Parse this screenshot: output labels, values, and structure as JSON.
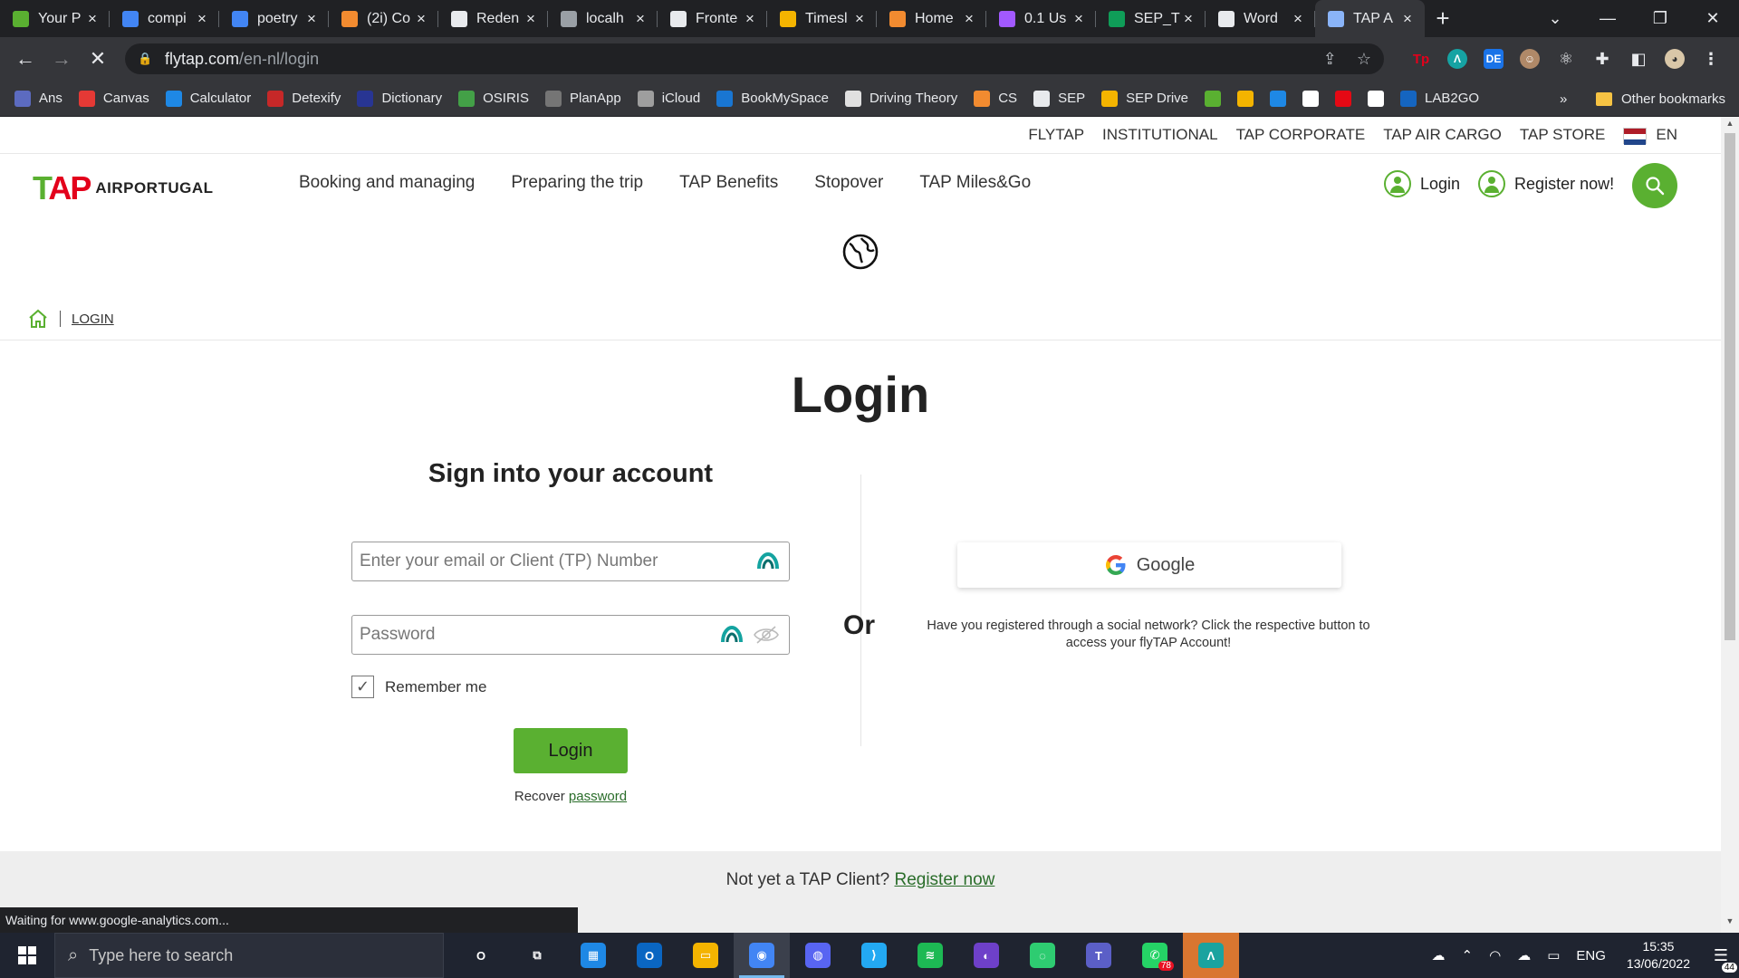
{
  "browser": {
    "tabs": [
      {
        "title": "Your P",
        "favicon": "six-icon",
        "color": "#5ab031"
      },
      {
        "title": "compi",
        "favicon": "google-icon",
        "color": "#4285f4"
      },
      {
        "title": "poetry",
        "favicon": "google-icon",
        "color": "#4285f4"
      },
      {
        "title": "(2i) Co",
        "favicon": "dots-icon",
        "color": "#f28b30"
      },
      {
        "title": "Reden",
        "favicon": "doc-icon",
        "color": "#e8eaed"
      },
      {
        "title": "localh",
        "favicon": "globe-icon",
        "color": "#9aa0a6"
      },
      {
        "title": "Fronte",
        "favicon": "github-icon",
        "color": "#e8eaed"
      },
      {
        "title": "Timesl",
        "favicon": "drive-icon",
        "color": "#f4b400"
      },
      {
        "title": "Home",
        "favicon": "ring-icon",
        "color": "#f28b30"
      },
      {
        "title": "0.1 Us",
        "favicon": "figma-icon",
        "color": "#a259ff"
      },
      {
        "title": "SEP_T",
        "favicon": "sheets-plus-icon",
        "color": "#0f9d58"
      },
      {
        "title": "Word",
        "favicon": "grid-icon",
        "color": "#e8eaed"
      },
      {
        "title": "TAP A",
        "favicon": "loading-icon",
        "color": "#8ab4f8",
        "active": true
      }
    ],
    "new_tab": "+",
    "url_host": "flytap.com",
    "url_path": "/en-nl/login",
    "bookmarks": [
      {
        "label": "Ans",
        "icon": "ans-icon",
        "color": "#5c6bc0"
      },
      {
        "label": "Canvas",
        "icon": "tu-delft-icon",
        "color": "#e53935"
      },
      {
        "label": "Calculator",
        "icon": "calculator-icon",
        "color": "#1e88e5"
      },
      {
        "label": "Detexify",
        "icon": "detexify-icon",
        "color": "#c62828"
      },
      {
        "label": "Dictionary",
        "icon": "dictionary-icon",
        "color": "#283593"
      },
      {
        "label": "OSIRIS",
        "icon": "osiris-icon",
        "color": "#43a047"
      },
      {
        "label": "PlanApp",
        "icon": "globe-icon",
        "color": "#757575"
      },
      {
        "label": "iCloud",
        "icon": "apple-icon",
        "color": "#9e9e9e"
      },
      {
        "label": "BookMySpace",
        "icon": "bookmyspace-icon",
        "color": "#1976d2"
      },
      {
        "label": "Driving Theory",
        "icon": "page-icon",
        "color": "#e0e0e0"
      },
      {
        "label": "CS",
        "icon": "dots-icon",
        "color": "#f28b30"
      },
      {
        "label": "SEP",
        "icon": "doc-icon",
        "color": "#e8eaed"
      },
      {
        "label": "SEP Drive",
        "icon": "drive-icon",
        "color": "#f4b400"
      },
      {
        "label": "",
        "icon": "six-icon",
        "color": "#5ab031"
      },
      {
        "label": "",
        "icon": "drive-icon",
        "color": "#f4b400"
      },
      {
        "label": "",
        "icon": "m-icon",
        "color": "#1e88e5"
      },
      {
        "label": "",
        "icon": "github-icon",
        "color": "#ffffff"
      },
      {
        "label": "",
        "icon": "netflix-icon",
        "color": "#e50914"
      },
      {
        "label": "",
        "icon": "no-icon",
        "color": "#ffffff"
      },
      {
        "label": "LAB2GO",
        "icon": "z-icon",
        "color": "#1565c0"
      }
    ],
    "bookmarks_more": "»",
    "other_bookmarks": "Other bookmarks",
    "status_text": "Waiting for www.google-analytics.com..."
  },
  "site": {
    "top_links": [
      "FLYTAP",
      "INSTITUTIONAL",
      "TAP CORPORATE",
      "TAP AIR CARGO",
      "TAP STORE"
    ],
    "language": "EN",
    "brand_mark": "TAP",
    "brand_name": "AIRPORTUGAL",
    "nav": [
      "Booking and managing",
      "Preparing the trip",
      "TAP Benefits",
      "Stopover",
      "TAP Miles&Go"
    ],
    "login_link": "Login",
    "register_link": "Register now!",
    "breadcrumb": "LOGIN",
    "page_title": "Login",
    "signin_heading": "Sign into your account",
    "email_placeholder": "Enter your email or Client (TP) Number",
    "password_placeholder": "Password",
    "remember_me": "Remember me",
    "remember_checked": true,
    "login_button": "Login",
    "recover_prefix": "Recover",
    "recover_link": "password",
    "or_label": "Or",
    "google_button": "Google",
    "social_text": "Have you registered through a social network? Click the respective button to access your flyTAP Account!",
    "not_client_prefix": "Not yet a TAP Client?",
    "register_now": "Register now",
    "accent_color": "#5ab031"
  },
  "taskbar": {
    "search_placeholder": "Type here to search",
    "apps": [
      {
        "name": "cortana-icon",
        "label": "O"
      },
      {
        "name": "task-view-icon",
        "label": "⧉"
      },
      {
        "name": "calendar-icon",
        "label": "▦"
      },
      {
        "name": "outlook-icon",
        "label": "O"
      },
      {
        "name": "file-explorer-icon",
        "label": "▭"
      },
      {
        "name": "chrome-icon",
        "label": "◉"
      },
      {
        "name": "discord-icon",
        "label": "◍"
      },
      {
        "name": "vscode-icon",
        "label": "⟩"
      },
      {
        "name": "spotify-icon",
        "label": "≋"
      },
      {
        "name": "github-desktop-icon",
        "label": "◐"
      },
      {
        "name": "loader-icon",
        "label": "◌"
      },
      {
        "name": "teams-icon",
        "label": "T"
      },
      {
        "name": "whatsapp-icon",
        "label": "✆"
      },
      {
        "name": "arc-icon",
        "label": "Λ"
      }
    ],
    "whatsapp_badge": "78",
    "language": "ENG",
    "time": "15:35",
    "date": "13/06/2022",
    "notifications": "44"
  }
}
